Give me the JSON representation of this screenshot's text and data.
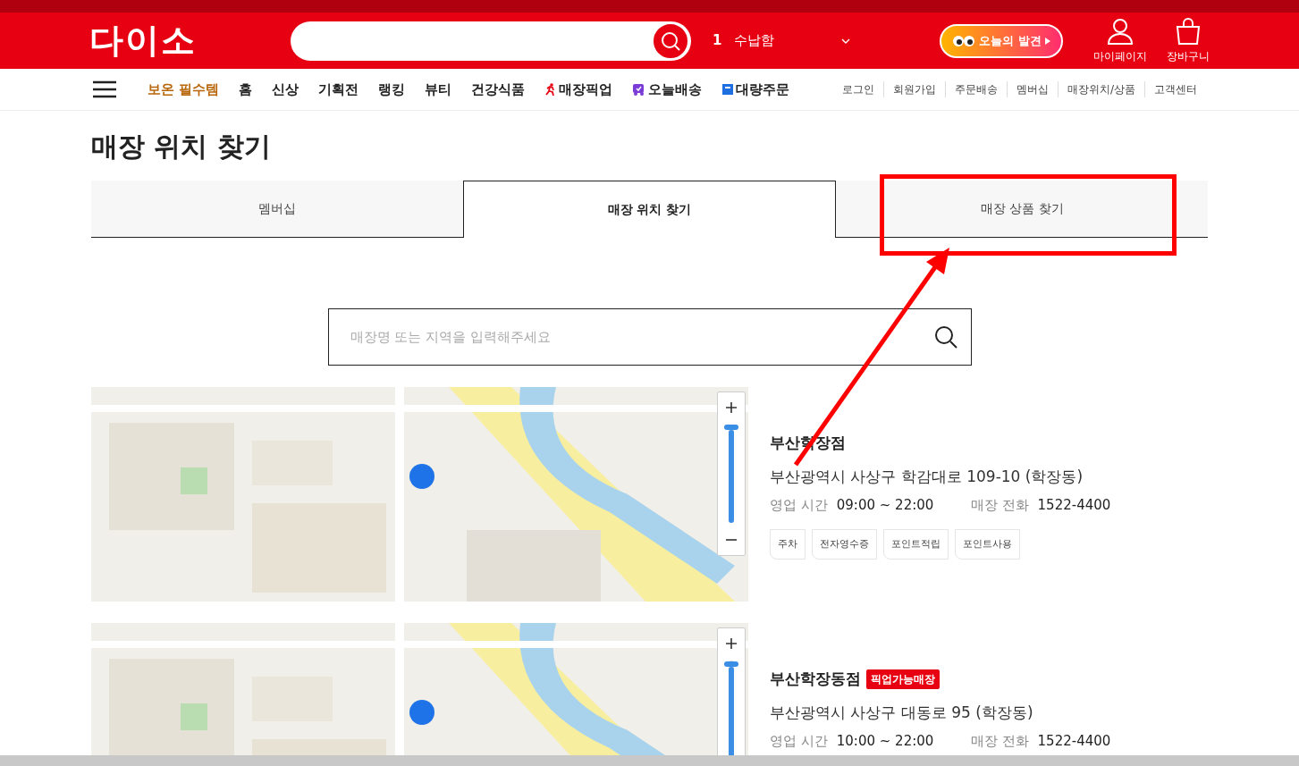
{
  "header": {
    "logo": "다이소",
    "ranking": {
      "rank": "1",
      "keyword": "수납함"
    },
    "promo": "오늘의 발견",
    "icons": [
      {
        "kind": "user",
        "label": "마이페이지"
      },
      {
        "kind": "bag",
        "label": "장바구니"
      }
    ]
  },
  "nav": {
    "items": [
      {
        "label": "보온 필수템",
        "kind": "highlight"
      },
      {
        "label": "홈",
        "kind": "plain"
      },
      {
        "label": "신상",
        "kind": "plain"
      },
      {
        "label": "기획전",
        "kind": "plain"
      },
      {
        "label": "랭킹",
        "kind": "plain"
      },
      {
        "label": "뷰티",
        "kind": "plain"
      },
      {
        "label": "건강식품",
        "kind": "plain"
      },
      {
        "label": "매장픽업",
        "kind": "pickup"
      },
      {
        "label": "오늘배송",
        "kind": "delivery"
      },
      {
        "label": "대량주문",
        "kind": "bulk"
      }
    ],
    "links": [
      "로그인",
      "회원가입",
      "주문배송",
      "멤버십",
      "매장위치/상품",
      "고객센터"
    ]
  },
  "page_title": "매장 위치 찾기",
  "tabs": [
    {
      "label": "멤버십",
      "selected": false
    },
    {
      "label": "매장 위치 찾기",
      "selected": true
    },
    {
      "label": "매장 상품 찾기",
      "selected": false
    }
  ],
  "store_search": {
    "placeholder": "매장명 또는 지역을 입력해주세요"
  },
  "stores": [
    {
      "name": "부산학장점",
      "address": "부산광역시 사상구 학감대로 109-10 (학장동)",
      "hours_label": "영업 시간",
      "hours": "09:00 ~ 22:00",
      "phone_label": "매장 전화",
      "phone": "1522-4400",
      "tags": [
        "주차",
        "전자영수증",
        "포인트적립",
        "포인트사용"
      ]
    },
    {
      "name": "부산학장동점",
      "pickup_badge": "픽업가능매장",
      "address": "부산광역시 사상구 대동로 95 (학장동)",
      "hours_label": "영업 시간",
      "hours": "10:00 ~ 22:00",
      "phone_label": "매장 전화",
      "phone": "1522-4400"
    }
  ],
  "annotation": {
    "kind": "box_arrow"
  }
}
